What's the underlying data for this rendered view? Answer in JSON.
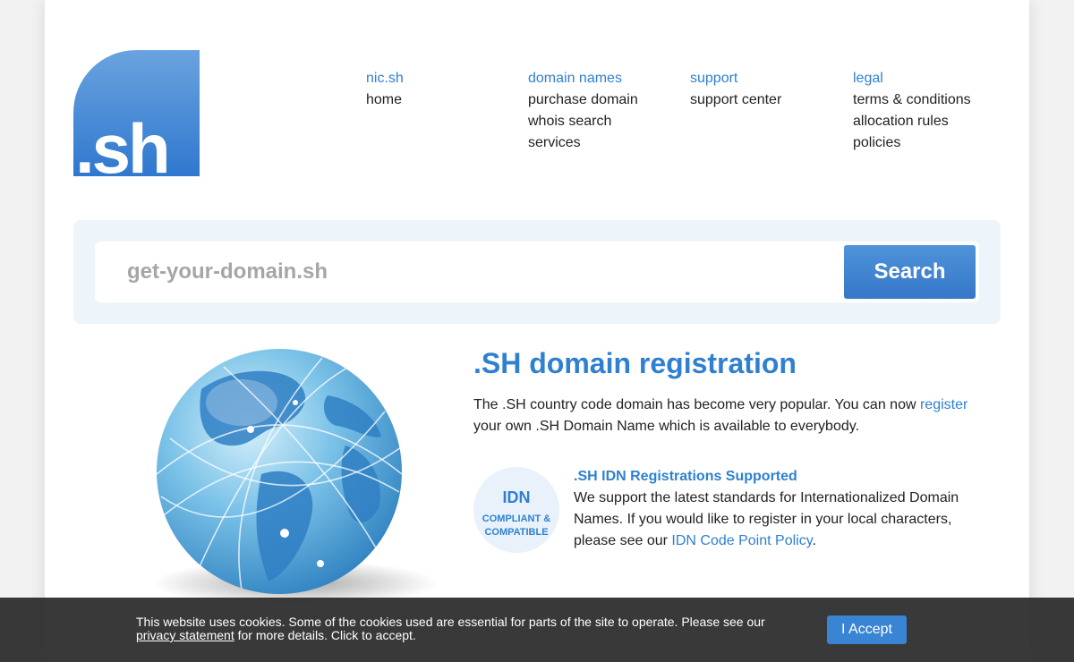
{
  "logo": {
    "text": ".sh",
    "color": "#3a80cf"
  },
  "nav": [
    {
      "heading": "nic.sh",
      "items": [
        "home"
      ]
    },
    {
      "heading": "domain names",
      "items": [
        "purchase domain",
        "whois search",
        "services"
      ]
    },
    {
      "heading": "support",
      "items": [
        "support center"
      ]
    },
    {
      "heading": "legal",
      "items": [
        "terms & conditions",
        "allocation rules",
        "policies"
      ]
    }
  ],
  "search": {
    "placeholder": "get-your-domain.sh",
    "value": "",
    "button_label": "Search"
  },
  "main": {
    "title": ".SH domain registration",
    "intro_before": "The .SH country code domain has become very popular. You can now ",
    "intro_link": "register",
    "intro_after": " your own .SH Domain Name which is available to everybody.",
    "idn_badge": {
      "line1": "IDN",
      "line2": "COMPLIANT &",
      "line3": "COMPATIBLE"
    },
    "idn_title": ".SH IDN Registrations Supported",
    "idn_text_before": "We support the latest standards for Internationalized Domain Names. If you would like to register in your local characters, please see our ",
    "idn_link": "IDN Code Point Policy",
    "idn_text_after": "."
  },
  "cookie": {
    "text_before": "This website uses cookies. Some of the cookies used are essential for parts of the site to operate. Please see our ",
    "link": "privacy statement",
    "text_after": " for more details. Click to accept.",
    "button_label": "I Accept"
  },
  "colors": {
    "accent": "#2f80d1",
    "search_bg": "#eef5fa",
    "cookie_bg": "#282828"
  }
}
